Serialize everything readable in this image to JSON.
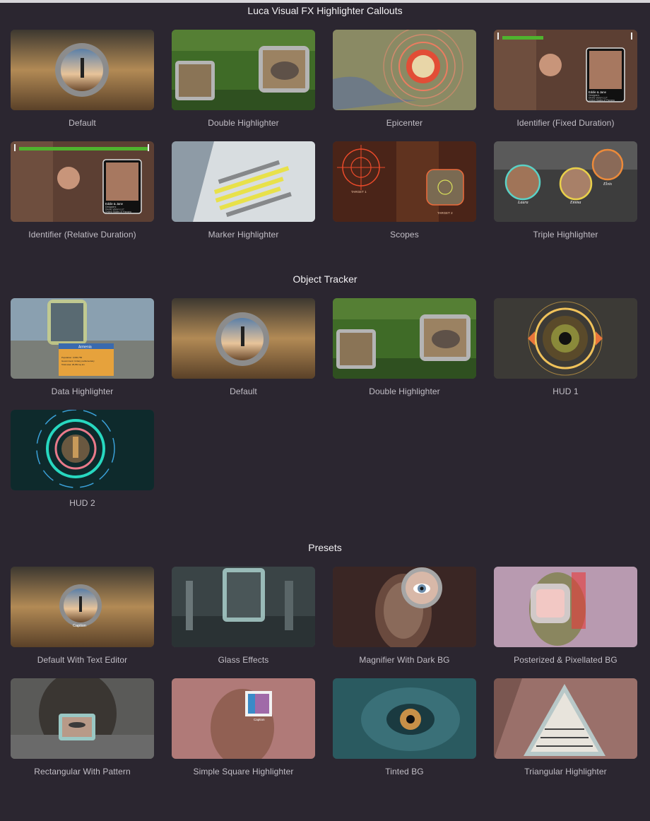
{
  "sections": [
    {
      "title": "Luca Visual FX Highlighter Callouts",
      "items": [
        {
          "label": "Default"
        },
        {
          "label": "Double Highlighter"
        },
        {
          "label": "Epicenter"
        },
        {
          "label": "Identifier (Fixed Duration)",
          "card": {
            "name": "Eddie & Jane",
            "l1": "Designers",
            "l2": "Divine Vision LLP",
            "l3": "United States of Pangea"
          }
        },
        {
          "label": "Identifier (Relative Duration)",
          "card": {
            "name": "Eddie & Jane",
            "l1": "Designers",
            "l2": "Divine Vision LLP",
            "l3": "United States of Pangea"
          }
        },
        {
          "label": "Marker Highlighter"
        },
        {
          "label": "Scopes",
          "t1": "TARGET 1",
          "t2": "TARGET 2"
        },
        {
          "label": "Triple Highlighter",
          "n1": "Laura",
          "n2": "Emma",
          "n3": "Elvis"
        }
      ]
    },
    {
      "title": "Object Tracker",
      "items": [
        {
          "label": "Data Highlighter",
          "card": {
            "name": "Armenia",
            "l1": "Population: 3,000,756",
            "l2": "Government: Unitary parliamentary",
            "l3": "Total area: 29,654 sq km"
          }
        },
        {
          "label": "Default"
        },
        {
          "label": "Double Highlighter"
        },
        {
          "label": "HUD 1"
        },
        {
          "label": "HUD 2"
        }
      ]
    },
    {
      "title": "Presets",
      "items": [
        {
          "label": "Default With Text Editor",
          "caption": "Caption"
        },
        {
          "label": "Glass Effects"
        },
        {
          "label": "Magnifier With Dark BG"
        },
        {
          "label": "Posterized & Pixellated BG"
        },
        {
          "label": "Rectangular With Pattern"
        },
        {
          "label": "Simple Square Highlighter",
          "caption": "Caption"
        },
        {
          "label": "Tinted BG"
        },
        {
          "label": "Triangular Highlighter"
        }
      ]
    }
  ]
}
